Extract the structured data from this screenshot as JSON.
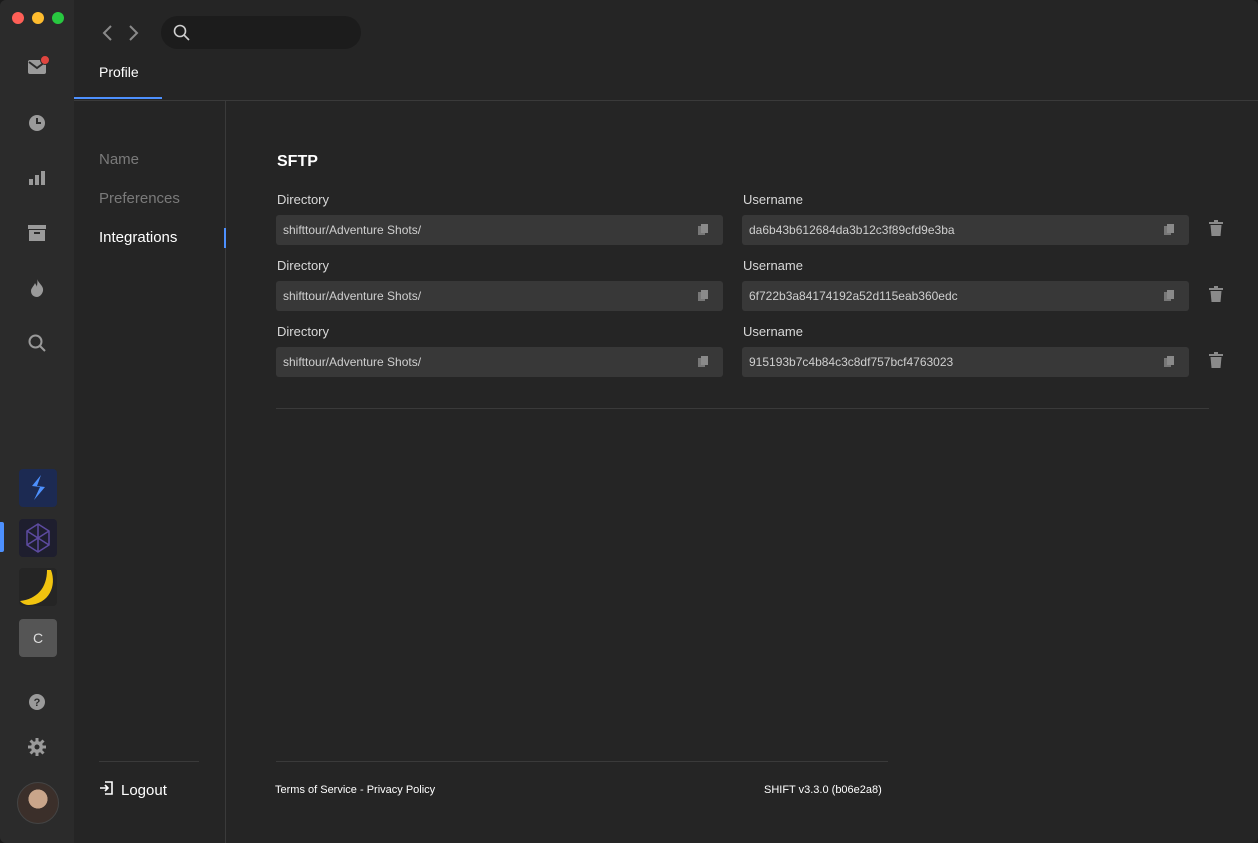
{
  "header": {
    "tab_label": "Profile",
    "search": {
      "placeholder": ""
    }
  },
  "subnav": {
    "items": [
      "Name",
      "Preferences",
      "Integrations"
    ],
    "active": "Integrations",
    "logout_label": "Logout"
  },
  "sftp": {
    "title": "SFTP",
    "directory_label": "Directory",
    "username_label": "Username",
    "rows": [
      {
        "directory": "shifttour/Adventure Shots/",
        "username": "da6b43b612684da3b12c3f89cfd9e3ba"
      },
      {
        "directory": "shifttour/Adventure Shots/",
        "username": "6f722b3a84174192a52d115eab360edc"
      },
      {
        "directory": "shifttour/Adventure Shots/",
        "username": "915193b7c4b84c3c8df757bcf4763023"
      }
    ]
  },
  "footer": {
    "terms": "Terms of Service",
    "separator": " - ",
    "privacy": "Privacy Policy",
    "version": "SHIFT v3.3.0 (b06e2a8)"
  },
  "rail": {
    "icons": [
      "mail-icon",
      "clock-icon",
      "chart-icon",
      "archive-icon",
      "fire-icon",
      "search-icon",
      "help-icon",
      "gear-icon"
    ],
    "apps": [
      "shift-app",
      "polyhedron-app",
      "banana-app",
      "c-app"
    ],
    "c_tile_label": "C"
  },
  "colors": {
    "accent": "#4d90fe",
    "badge": "#e0453f"
  }
}
